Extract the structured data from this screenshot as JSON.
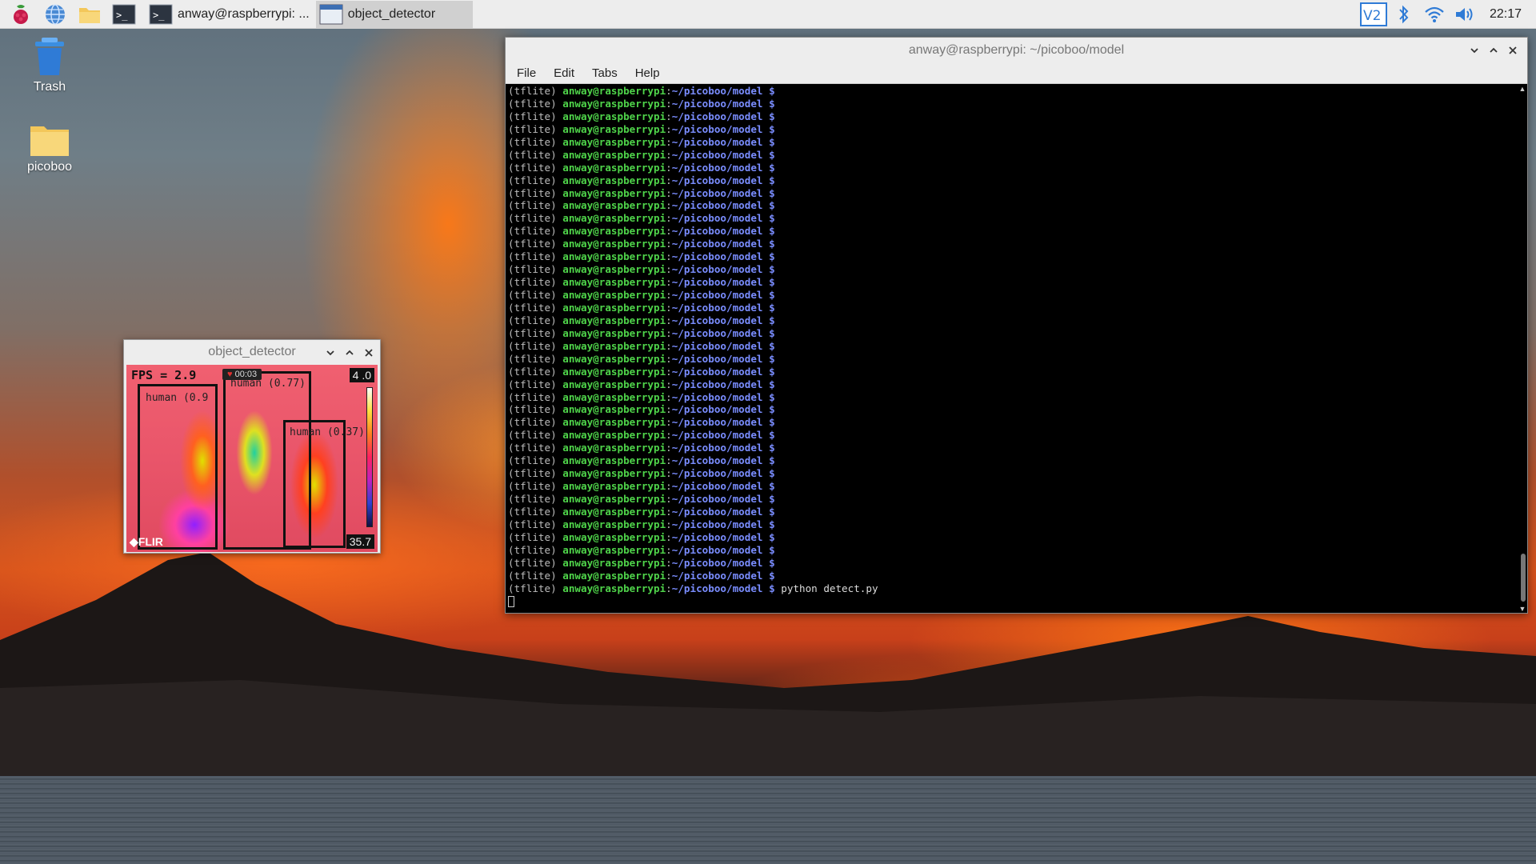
{
  "taskbar": {
    "tasks": [
      {
        "label": "anway@raspberrypi: ..."
      },
      {
        "label": "object_detector"
      }
    ],
    "clock": "22:17"
  },
  "desktop": {
    "icons": [
      {
        "label": "Trash"
      },
      {
        "label": "picoboo"
      }
    ]
  },
  "terminal": {
    "title": "anway@raspberrypi: ~/picoboo/model",
    "menu": [
      "File",
      "Edit",
      "Tabs",
      "Help"
    ],
    "prompt": {
      "env": "(tflite)",
      "user_host": "anway@raspberrypi",
      "path": "~/picoboo/model",
      "symbol": "$"
    },
    "empty_prompt_count": 39,
    "last_command": "python detect.py"
  },
  "object_detector": {
    "title": "object_detector",
    "fps": "FPS = 2.9",
    "rec_time": "00:03",
    "temp_high": "4 .0",
    "temp_low": "35.7",
    "brand": "FLIR",
    "detections": [
      {
        "label": "human (0.9"
      },
      {
        "label": "human (0.77)"
      },
      {
        "label": "human (0.37)"
      }
    ]
  },
  "colors": {
    "prompt_user": "#4fd44a",
    "prompt_path": "#7a8dff",
    "taskbar_bg": "#ededed"
  }
}
